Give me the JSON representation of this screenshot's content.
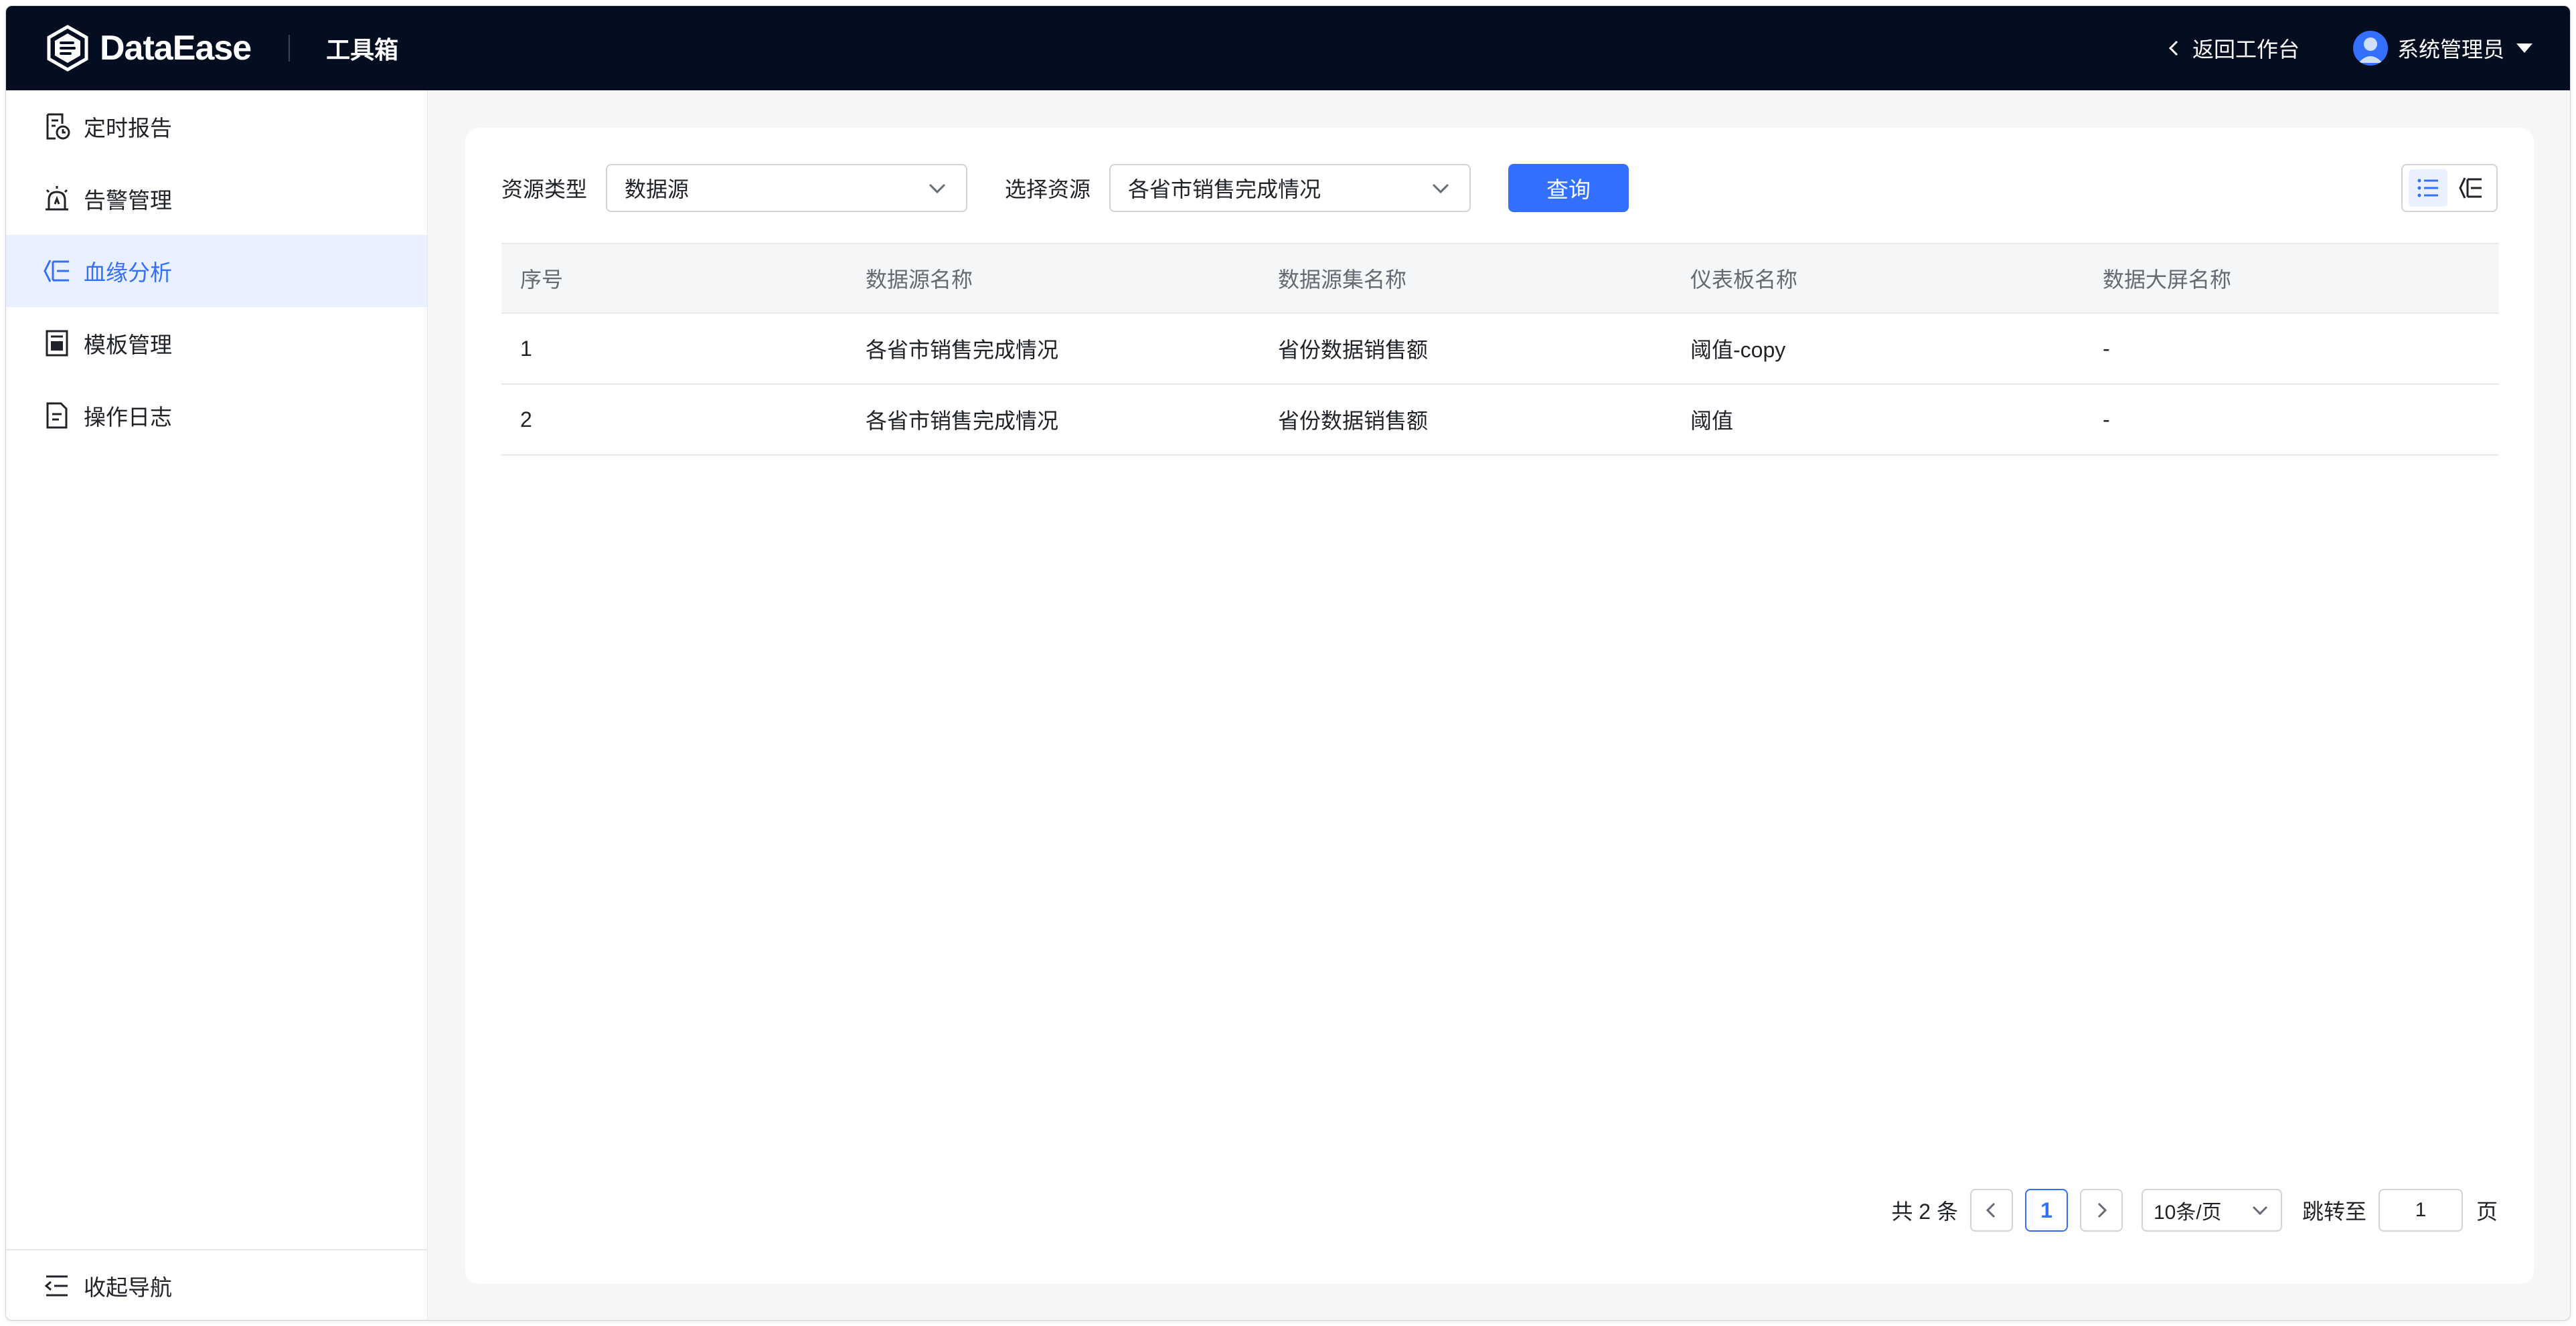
{
  "header": {
    "brand": "DataEase",
    "app_name": "工具箱",
    "back_label": "返回工作台",
    "user_name": "系统管理员"
  },
  "sidebar": {
    "items": [
      {
        "label": "定时报告",
        "icon": "scheduled-report-icon"
      },
      {
        "label": "告警管理",
        "icon": "alarm-icon"
      },
      {
        "label": "血缘分析",
        "icon": "lineage-icon",
        "active": true
      },
      {
        "label": "模板管理",
        "icon": "template-icon"
      },
      {
        "label": "操作日志",
        "icon": "log-icon"
      }
    ],
    "collapse_label": "收起导航"
  },
  "filters": {
    "resource_type_label": "资源类型",
    "resource_type_value": "数据源",
    "select_resource_label": "选择资源",
    "select_resource_value": "各省市销售完成情况",
    "query_label": "查询"
  },
  "table": {
    "columns": [
      "序号",
      "数据源名称",
      "数据源集名称",
      "仪表板名称",
      "数据大屏名称"
    ],
    "rows": [
      [
        "1",
        "各省市销售完成情况",
        "省份数据销售额",
        "阈值-copy",
        "-"
      ],
      [
        "2",
        "各省市销售完成情况",
        "省份数据销售额",
        "阈值",
        "-"
      ]
    ]
  },
  "pagination": {
    "total_text": "共 2 条",
    "current_page": "1",
    "page_size": "10条/页",
    "jump_label": "跳转至",
    "jump_value": "1",
    "page_unit": "页"
  },
  "colors": {
    "header_bg": "#050e21",
    "accent": "#3370ff",
    "active_bg": "#e9f0ff"
  }
}
